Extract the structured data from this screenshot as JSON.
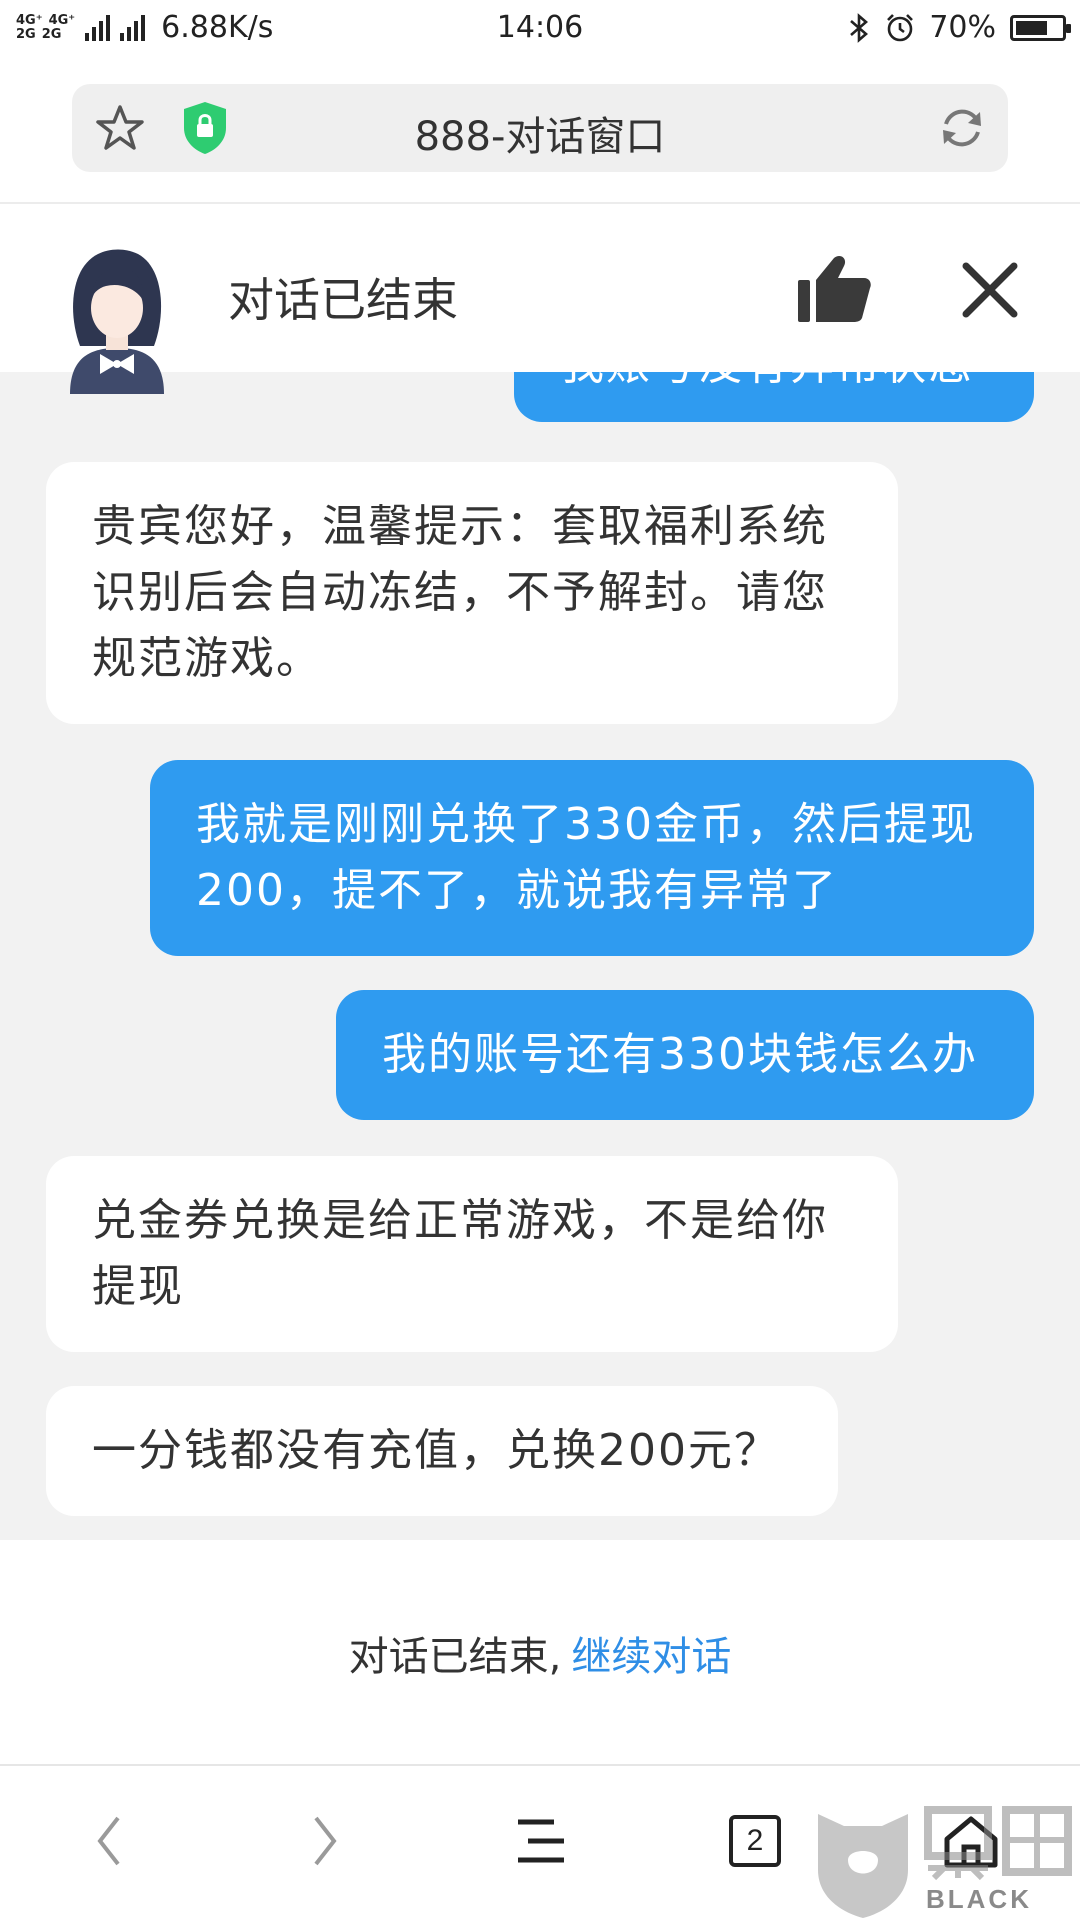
{
  "status_bar": {
    "net_top": [
      "4G⁺",
      "4G⁺"
    ],
    "net_bottom": [
      "⁺⁺",
      "2G",
      "2G"
    ],
    "speed": "6.88K/s",
    "time": "14:06",
    "battery_pct": "70%",
    "battery_level": 0.7,
    "icons": [
      "bluetooth-icon",
      "alarm-icon",
      "battery-icon",
      "signal-icon"
    ]
  },
  "browser": {
    "page_title": "888-对话窗口",
    "icons": [
      "star-icon",
      "security-shield-icon",
      "reload-icon"
    ]
  },
  "chat": {
    "status_title": "对话已结束",
    "messages": [
      {
        "role": "user",
        "text": "我账号没有异常状态"
      },
      {
        "role": "agent",
        "text": "贵宾您好，温馨提示：套取福利系统识别后会自动冻结，不予解封。请您规范游戏。"
      },
      {
        "role": "user",
        "text": "我就是刚刚兑换了330金币，然后提现200，提不了，就说我有异常了"
      },
      {
        "role": "user",
        "text": "我的账号还有330块钱怎么办"
      },
      {
        "role": "agent",
        "text": "兑金券兑换是给正常游戏，不是给你提现"
      },
      {
        "role": "agent",
        "text": "一分钱都没有充值，兑换200元？"
      }
    ]
  },
  "ended_bar": {
    "text": "对话已结束,",
    "link": "继续对话"
  },
  "bottom_nav": {
    "tab_count": "2",
    "icons": [
      "back-icon",
      "forward-icon",
      "menu-icon",
      "tabs-icon",
      "home-icon"
    ]
  },
  "watermark": {
    "brand": "BLACK CAT"
  },
  "colors": {
    "user_bubble": "#2f9bf0",
    "agent_bubble": "#ffffff",
    "chat_background": "#f2f2f2",
    "link": "#2f8ee6",
    "shield": "#2ecc71"
  }
}
